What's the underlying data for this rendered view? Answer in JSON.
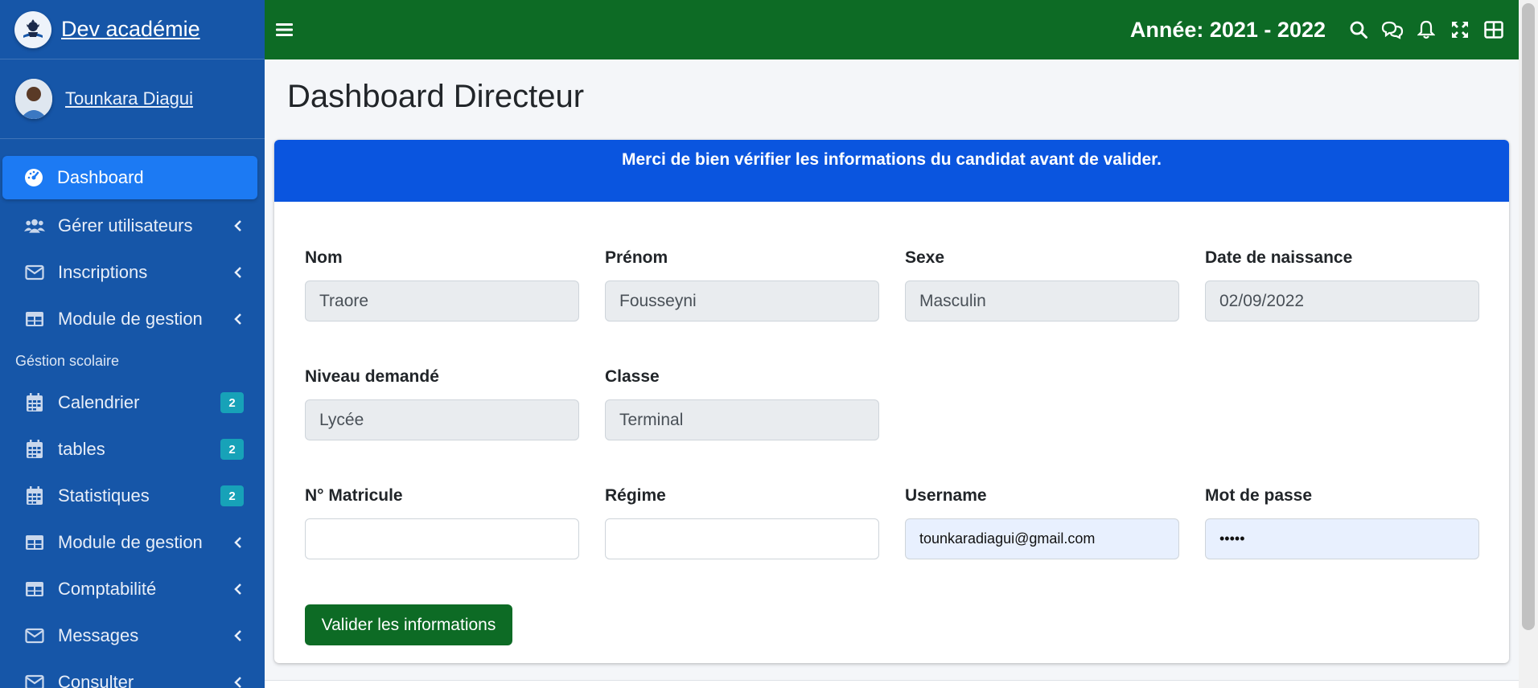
{
  "brand": {
    "name": "Dev académie"
  },
  "user": {
    "name": "Tounkara Diagui"
  },
  "sidebar": {
    "items": [
      {
        "label": "Dashboard",
        "icon": "tachometer-icon",
        "active": true
      },
      {
        "label": "Gérer utilisateurs",
        "icon": "users-icon"
      },
      {
        "label": "Inscriptions",
        "icon": "envelope-icon"
      },
      {
        "label": "Module de gestion",
        "icon": "table-icon"
      }
    ],
    "section_header": "Géstion scolaire",
    "items2": [
      {
        "label": "Calendrier",
        "icon": "calendar-icon",
        "badge": "2"
      },
      {
        "label": "tables",
        "icon": "calendar-icon",
        "badge": "2"
      },
      {
        "label": "Statistiques",
        "icon": "calendar-icon",
        "badge": "2"
      },
      {
        "label": "Module de gestion",
        "icon": "table-icon"
      },
      {
        "label": "Comptabilité",
        "icon": "table-icon"
      },
      {
        "label": "Messages",
        "icon": "envelope-icon"
      },
      {
        "label": "Consulter",
        "icon": "envelope-icon"
      }
    ]
  },
  "topbar": {
    "year": "Année: 2021 - 2022",
    "icons": [
      "search-icon",
      "comments-icon",
      "bell-icon",
      "expand-icon",
      "grid-icon"
    ]
  },
  "page": {
    "title": "Dashboard Directeur"
  },
  "card": {
    "header": "Merci de bien vérifier les informations du candidat avant de valider."
  },
  "form": {
    "nom": {
      "label": "Nom",
      "value": "Traore"
    },
    "prenom": {
      "label": "Prénom",
      "value": "Fousseyni"
    },
    "sexe": {
      "label": "Sexe",
      "value": "Masculin"
    },
    "date_naissance": {
      "label": "Date de naissance",
      "value": "02/09/2022"
    },
    "niveau": {
      "label": "Niveau demandé",
      "value": "Lycée"
    },
    "classe": {
      "label": "Classe",
      "value": "Terminal"
    },
    "matricule": {
      "label": "N° Matricule",
      "value": ""
    },
    "regime": {
      "label": "Régime",
      "value": ""
    },
    "username": {
      "label": "Username",
      "value": "tounkaradiagui@gmail.com"
    },
    "password": {
      "label": "Mot de passe",
      "value": "•••••"
    },
    "submit_label": "Valider les informations"
  },
  "colors": {
    "sidebar": "#1656a8",
    "active_item": "#1c7af3",
    "topbar": "#0d6b25",
    "card_header": "#0a55df",
    "badge": "#17a2b8",
    "submit": "#0d6b25"
  }
}
